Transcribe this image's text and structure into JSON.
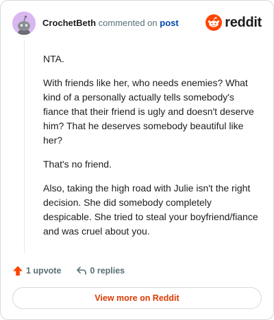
{
  "header": {
    "username": "CrochetBeth",
    "commented_text": "commented on",
    "post_link": "post"
  },
  "logo": {
    "text": "reddit",
    "icon": "reddit-snoo-icon",
    "brand_color": "#ff4500"
  },
  "comment": {
    "paragraphs": [
      "NTA.",
      "With friends like her, who needs enemies? What kind of a personally actually tells somebody's fiance that their friend is ugly and doesn't deserve him? That he deserves somebody beautiful like her?",
      "That's no friend.",
      "Also, taking the high road with Julie isn't the right decision. She did somebody completely despicable. She tried to steal your boyfriend/fiance and was cruel about you."
    ]
  },
  "actions": {
    "upvotes": "1 upvote",
    "replies": "0 replies",
    "upvote_icon": "upvote-arrow-icon",
    "reply_icon": "reply-arrow-icon",
    "upvote_color": "#ff4500"
  },
  "footer": {
    "view_more": "View more on Reddit",
    "accent": "#d93a00"
  }
}
